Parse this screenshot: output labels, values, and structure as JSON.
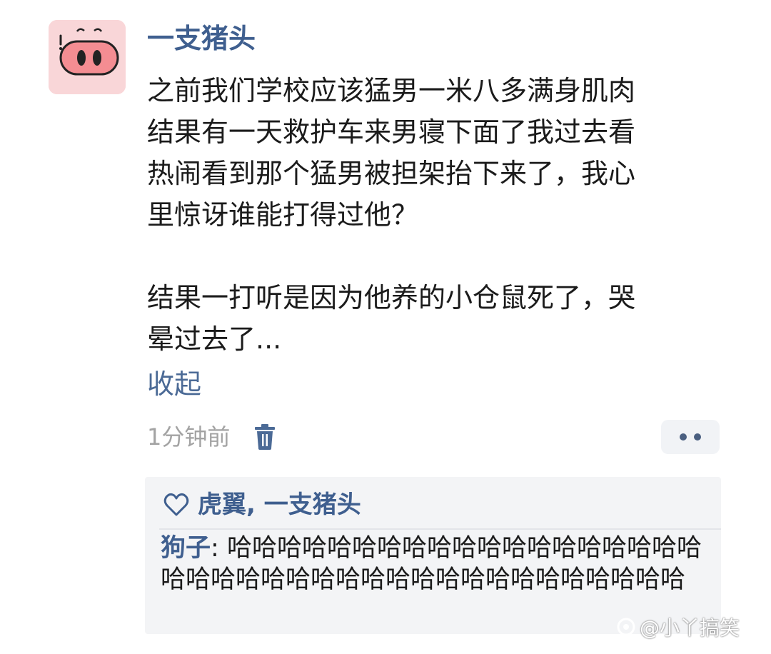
{
  "comment": {
    "username": "一支猪头",
    "lines_part1": [
      "之前我们学校应该猛男一米八多满身肌肉",
      "结果有一天救护车来男寝下面了我过去看",
      "热闹看到那个猛男被担架抬下来了，我心",
      "里惊讶谁能打得过他？"
    ],
    "lines_part2": [
      "结果一打听是因为他养的小仓鼠死了，哭",
      "晕过去了..."
    ],
    "collapse_label": "收起",
    "timestamp": "1分钟前",
    "delete_icon": "trash-icon",
    "more_icon": "more-dots-icon"
  },
  "likes": {
    "icon": "heart-icon",
    "names": "虎翼, 一支猪头"
  },
  "reply": {
    "author": "狗子",
    "separator": ": ",
    "text": "哈哈哈哈哈哈哈哈哈哈哈哈哈哈哈哈哈哈哈哈哈哈哈哈哈哈哈哈哈哈哈哈哈哈哈哈哈哈哈哈"
  },
  "watermark": {
    "icon": "watermark-logo-icon",
    "text": "@小丫搞笑"
  },
  "colors": {
    "username": "#3f5f8f",
    "link": "#4b6a96",
    "timestamp": "#a3a3a3",
    "avatar_bg": "#f9d6d8",
    "reply_bg": "#f3f4f6"
  }
}
